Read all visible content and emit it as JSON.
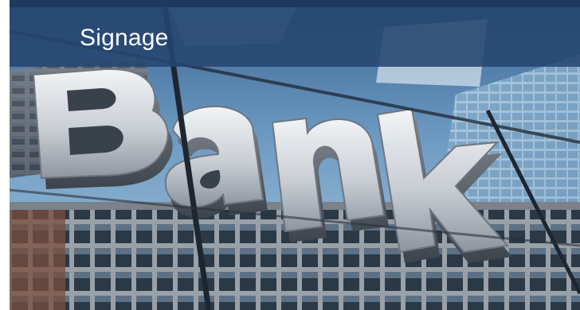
{
  "header": {
    "title": "Signage"
  },
  "photo": {
    "sign_text": "Bank"
  },
  "colors": {
    "title_bar": "#264670",
    "top_rule": "#1d3a5e",
    "title_text": "#ffffff"
  }
}
